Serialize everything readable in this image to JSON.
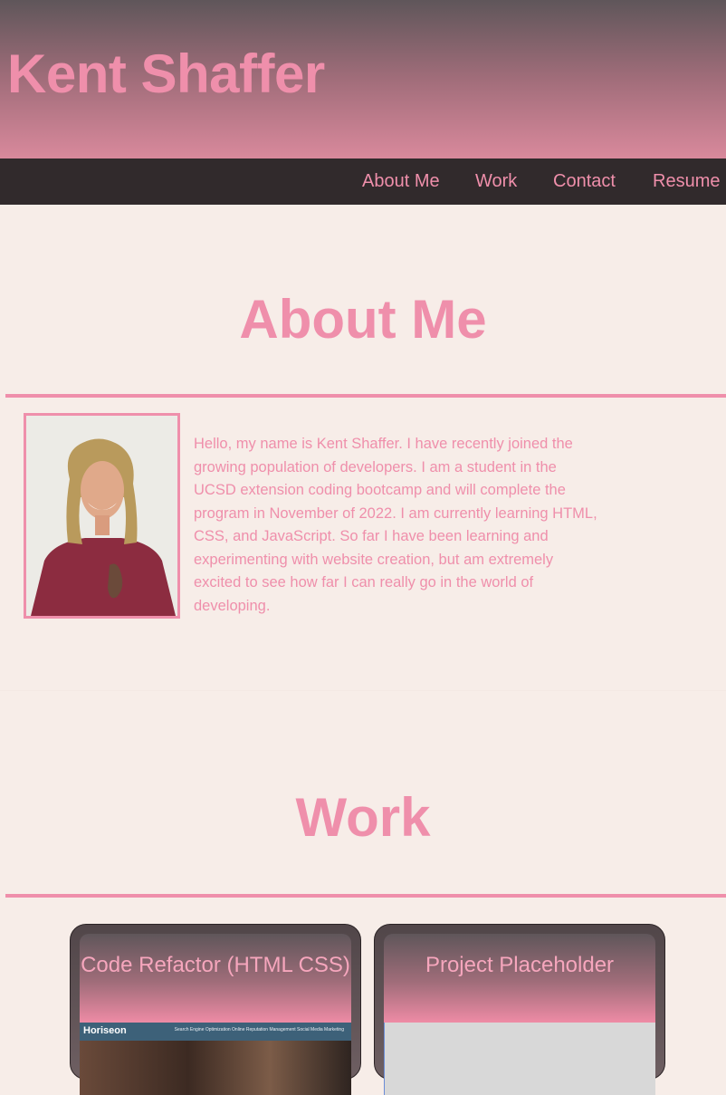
{
  "header": {
    "title": "Kent Shaffer"
  },
  "nav": {
    "items": [
      "About Me",
      "Work",
      "Contact",
      "Resume"
    ]
  },
  "about": {
    "title": "About Me",
    "bio": "Hello, my name is Kent Shaffer. I have recently joined the growing population of developers. I am a student in the UCSD extension coding bootcamp and will complete the program in November of 2022. I am currently learning HTML, CSS, and JavaScript. So far I have been learning and experimenting with website creation, but am extremely excited to see how far I can really go in the world of developing."
  },
  "work": {
    "title": "Work",
    "projects": [
      {
        "title": "Code Refactor (HTML CSS)",
        "preview": {
          "brand": "Horiseon",
          "links": "Search Engine Optimization    Online Reputation Management    Social Media Marketing"
        }
      },
      {
        "title": "Project Placeholder"
      }
    ]
  },
  "colors": {
    "accent": "#ef8fab",
    "background": "#f7ede8",
    "navbar": "#312a2c"
  }
}
